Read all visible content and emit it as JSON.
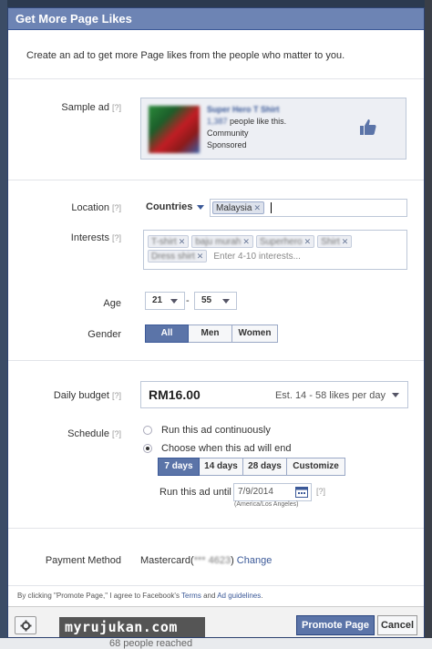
{
  "dialog": {
    "title": "Get More Page Likes",
    "intro": "Create an ad to get more Page likes from the people who matter to you."
  },
  "help_mark": "[?]",
  "sample_ad": {
    "label": "Sample ad",
    "page_name": "Super Hero T Shirt",
    "likes_count": "1,387",
    "likes_text": "people like this.",
    "category": "Community",
    "sponsored": "Sponsored",
    "like_icon": "thumbs-up-icon"
  },
  "location": {
    "label": "Location",
    "type": "Countries",
    "tokens": [
      "Malaysia"
    ]
  },
  "interests": {
    "label": "Interests",
    "tokens": [
      "T-shirt",
      "baju murah",
      "Superhero",
      "Shirt",
      "Dress shirt"
    ],
    "placeholder": "Enter 4-10 interests..."
  },
  "age": {
    "label": "Age",
    "min": "21",
    "separator": "-",
    "max": "55"
  },
  "gender": {
    "label": "Gender",
    "options": [
      "All",
      "Men",
      "Women"
    ],
    "selected": "All"
  },
  "budget": {
    "label": "Daily budget",
    "amount": "RM16.00",
    "estimate": "Est. 14 - 58 likes per day"
  },
  "schedule": {
    "label": "Schedule",
    "option_continuous": "Run this ad continuously",
    "option_choose": "Choose when this ad will end",
    "selected": "Choose when this ad will end",
    "durations": [
      "7 days",
      "14 days",
      "28 days",
      "Customize"
    ],
    "duration_selected": "7 days",
    "run_until_label": "Run this ad until",
    "end_date": "7/9/2014",
    "timezone": "(America/Los Angeles)"
  },
  "payment": {
    "label": "Payment Method",
    "method": "Mastercard(",
    "masked_number": "*** 4623",
    "close": ")",
    "change": "Change"
  },
  "terms": {
    "prefix": "By clicking \"Promote Page,\" I agree to Facebook's",
    "terms_link": "Terms",
    "and": "and",
    "guidelines_link": "Ad guidelines",
    "suffix": "."
  },
  "footer": {
    "watermark": "myrujukan.com",
    "promote_label": "Promote Page",
    "cancel_label": "Cancel"
  },
  "background": {
    "reached_text": "68 people reached"
  },
  "colors": {
    "header_blue": "#6d84b4",
    "button_blue": "#5b74a8",
    "link_blue": "#3b5998"
  }
}
